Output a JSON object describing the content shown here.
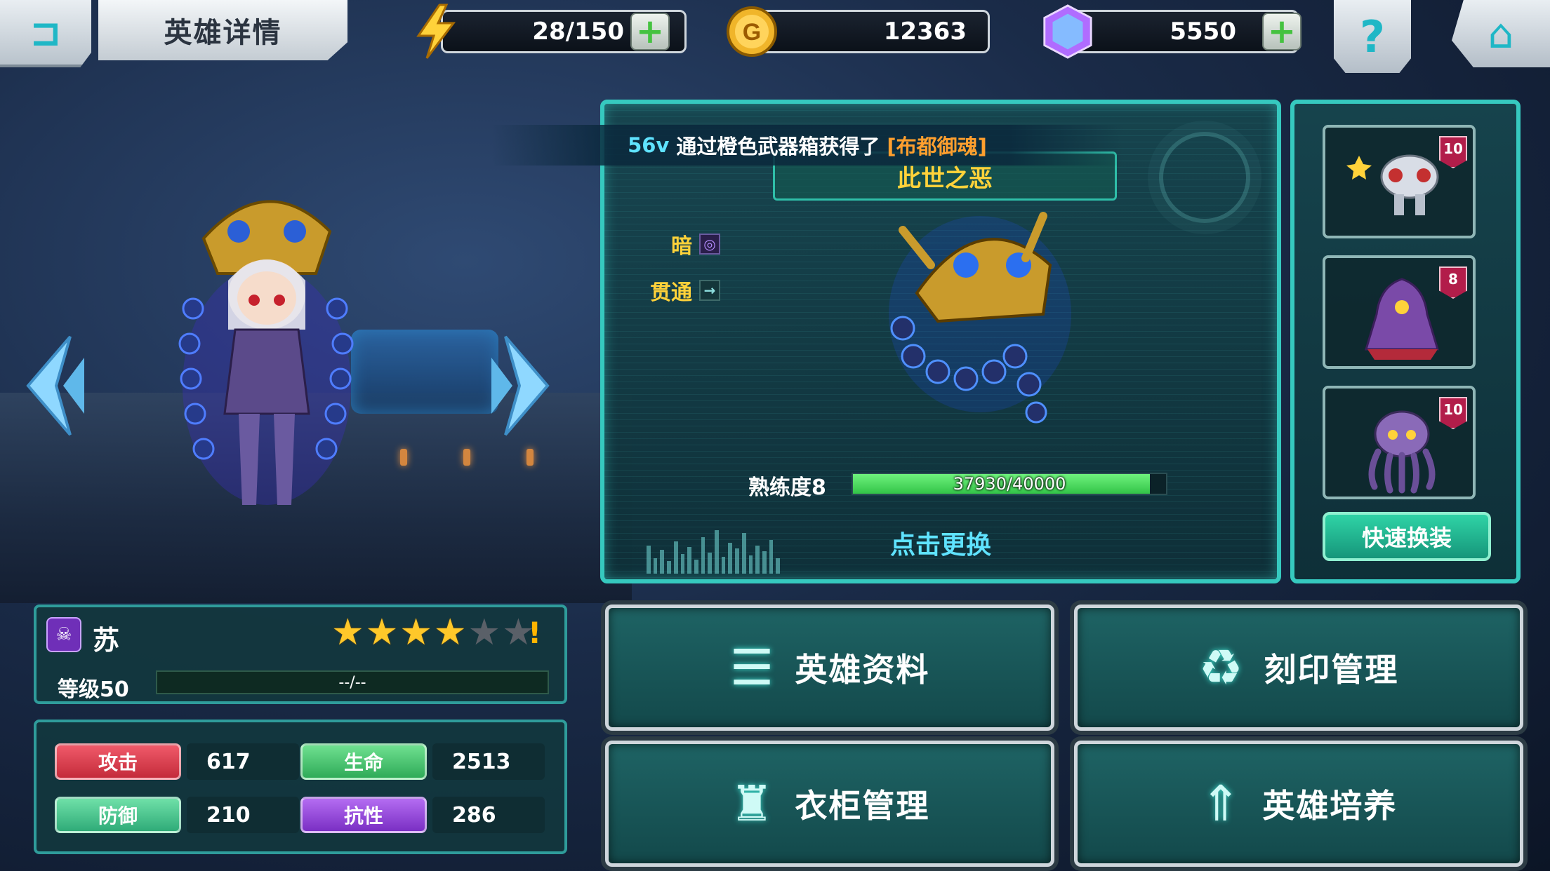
{
  "header": {
    "title": "英雄详情",
    "stamina": "28/150",
    "gold": "12363",
    "gems": "5550",
    "gold_icon_letter": "G",
    "help_glyph": "?"
  },
  "notice": {
    "player": "56v",
    "message": "通过橙色武器箱获得了",
    "item": "[布都御魂]"
  },
  "weapon": {
    "name": "此世之恶",
    "attributes": [
      {
        "label": "暗",
        "icon": "dark-swirl-icon"
      },
      {
        "label": "贯通",
        "icon": "pierce-arrow-icon"
      }
    ],
    "proficiency_label": "熟练度8",
    "proficiency_value": "37930/40000",
    "proficiency_fraction": 0.948,
    "swap_label": "点击更换"
  },
  "equipment": {
    "slots": [
      {
        "icon": "mech-armor-icon",
        "level": "10"
      },
      {
        "icon": "purple-cloak-icon",
        "level": "8"
      },
      {
        "icon": "octopus-icon",
        "level": "10"
      }
    ],
    "quick_swap_label": "快速换装"
  },
  "hero": {
    "name": "苏",
    "stars_filled": 4,
    "stars_total": 6,
    "alert": "!",
    "level_label": "等级50",
    "level_progress": "--/--"
  },
  "stats": {
    "atk_label": "攻击",
    "atk": "617",
    "hp_label": "生命",
    "hp": "2513",
    "def_label": "防御",
    "def": "210",
    "res_label": "抗性",
    "res": "286"
  },
  "menu": {
    "hero_info": "英雄资料",
    "imprint": "刻印管理",
    "wardrobe": "衣柜管理",
    "train": "英雄培养"
  },
  "colors": {
    "accent": "#36c9bf",
    "gold_text": "#ffd23a",
    "notice_item": "#ff9f2e",
    "notice_player": "#5fe3ff"
  }
}
